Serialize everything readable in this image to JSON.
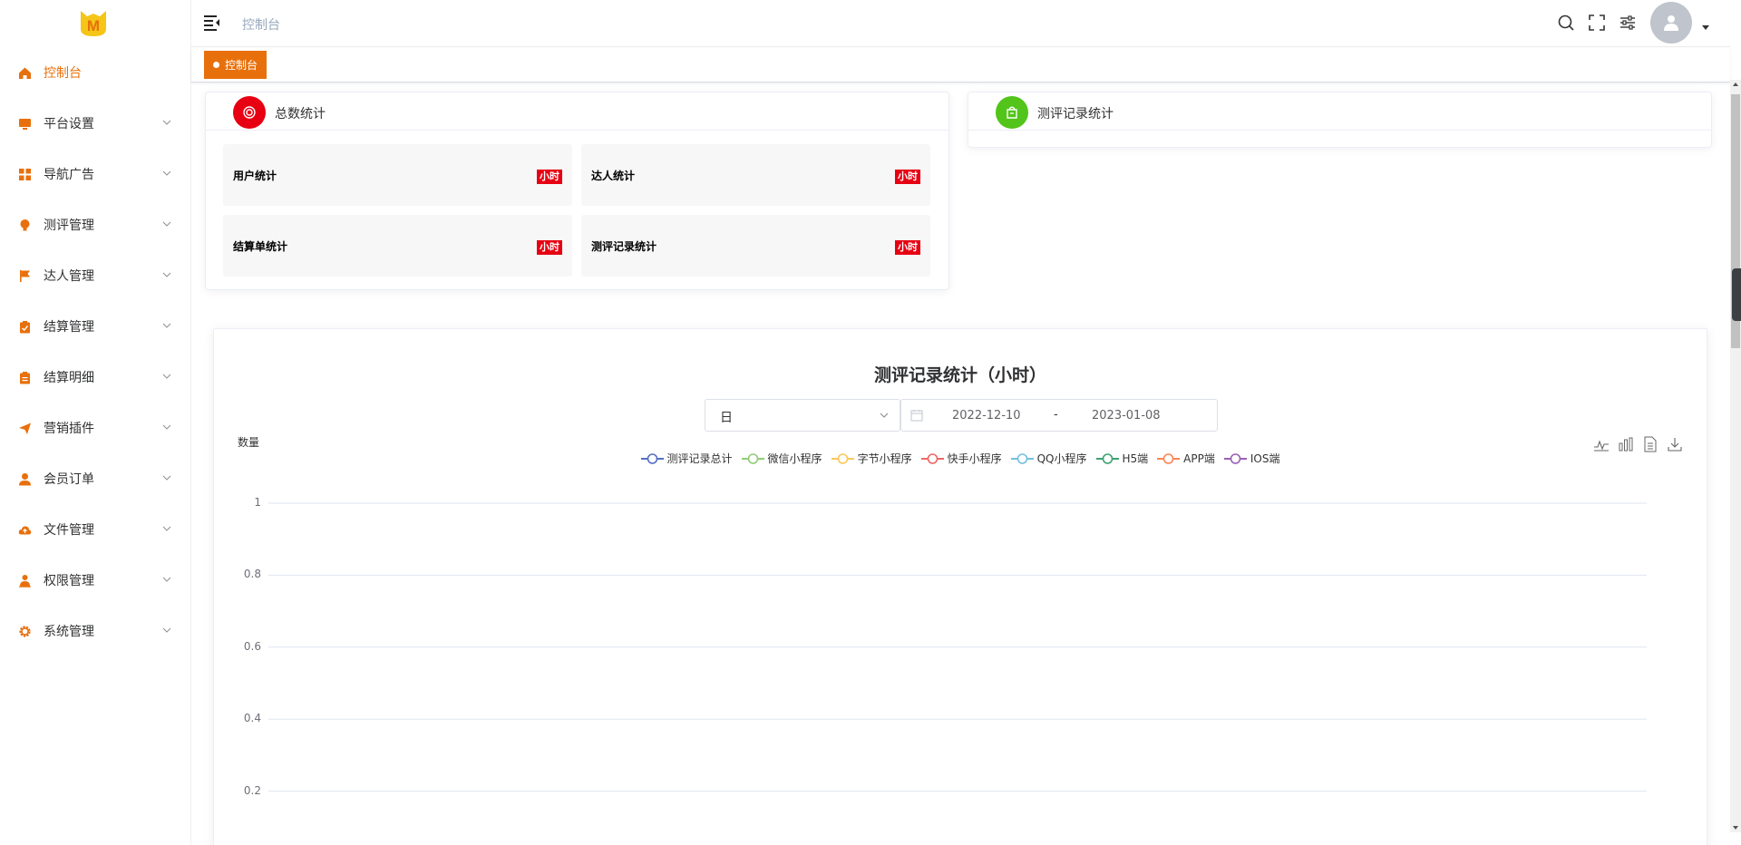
{
  "header": {
    "breadcrumb": "控制台"
  },
  "tags": {
    "active_label": "控制台"
  },
  "sidebar": {
    "items": [
      {
        "label": "控制台",
        "icon": "home-icon",
        "active": true,
        "expandable": false
      },
      {
        "label": "平台设置",
        "icon": "monitor-icon",
        "active": false,
        "expandable": true
      },
      {
        "label": "导航广告",
        "icon": "grid-icon",
        "active": false,
        "expandable": true
      },
      {
        "label": "测评管理",
        "icon": "bulb-icon",
        "active": false,
        "expandable": true
      },
      {
        "label": "达人管理",
        "icon": "flag-icon",
        "active": false,
        "expandable": true
      },
      {
        "label": "结算管理",
        "icon": "clipboard-check-icon",
        "active": false,
        "expandable": true
      },
      {
        "label": "结算明细",
        "icon": "clipboard-list-icon",
        "active": false,
        "expandable": true
      },
      {
        "label": "营销插件",
        "icon": "paper-plane-icon",
        "active": false,
        "expandable": true
      },
      {
        "label": "会员订单",
        "icon": "user-icon",
        "active": false,
        "expandable": true
      },
      {
        "label": "文件管理",
        "icon": "cloud-upload-icon",
        "active": false,
        "expandable": true
      },
      {
        "label": "权限管理",
        "icon": "user-shield-icon",
        "active": false,
        "expandable": true
      },
      {
        "label": "系统管理",
        "icon": "gear-icon",
        "active": false,
        "expandable": true
      }
    ]
  },
  "totals_card": {
    "title": "总数统计",
    "stats": [
      {
        "name": "用户统计",
        "unit": "小时"
      },
      {
        "name": "达人统计",
        "unit": "小时"
      },
      {
        "name": "结算单统计",
        "unit": "小时"
      },
      {
        "name": "测评记录统计",
        "unit": "小时"
      }
    ]
  },
  "records_card": {
    "title": "测评记录统计"
  },
  "chart_panel": {
    "title": "测评记录统计（小时）",
    "granularity": "日",
    "date_start": "2022-12-10",
    "date_sep": "-",
    "date_end": "2023-01-08"
  },
  "colors": {
    "accent": "#e8700c",
    "red_badge": "#e60012",
    "green_badge": "#52c41a"
  },
  "chart_data": {
    "type": "line",
    "ylabel": "数量",
    "ylim": [
      0,
      1
    ],
    "yticks": [
      "1",
      "0.8",
      "0.6",
      "0.4",
      "0.2"
    ],
    "grid": true,
    "legend_position": "top-center",
    "series": [
      {
        "name": "测评记录总计",
        "color": "#5470c6",
        "values": []
      },
      {
        "name": "微信小程序",
        "color": "#91cc75",
        "values": []
      },
      {
        "name": "字节小程序",
        "color": "#fac858",
        "values": []
      },
      {
        "name": "快手小程序",
        "color": "#ee6666",
        "values": []
      },
      {
        "name": "QQ小程序",
        "color": "#73c0de",
        "values": []
      },
      {
        "name": "H5端",
        "color": "#3ba272",
        "values": []
      },
      {
        "name": "APP端",
        "color": "#fc8452",
        "values": []
      },
      {
        "name": "IOS端",
        "color": "#9a60b4",
        "values": []
      }
    ]
  }
}
